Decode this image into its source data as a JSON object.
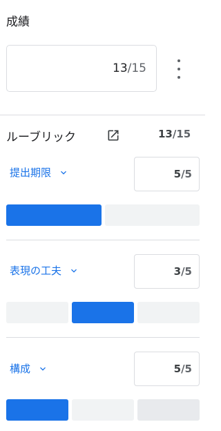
{
  "grade": {
    "title": "成績",
    "value": "13",
    "total": "/15"
  },
  "rubric": {
    "title": "ルーブリック",
    "score": "13",
    "total": "/15",
    "criteria": [
      {
        "label": "提出期限",
        "score": "5",
        "total": "/5",
        "levels_count": 2,
        "selected_level": 1
      },
      {
        "label": "表現の工夫",
        "score": "3",
        "total": "/5",
        "levels_count": 3,
        "selected_level": 2
      },
      {
        "label": "構成",
        "score": "5",
        "total": "/5",
        "levels_count": 3,
        "selected_level": 1
      }
    ]
  },
  "colors": {
    "accent": "#1a73e8",
    "level_unselected": "#f1f3f4"
  },
  "icons": [
    "more-vert-icon",
    "open-in-new-icon",
    "chevron-down-icon"
  ]
}
